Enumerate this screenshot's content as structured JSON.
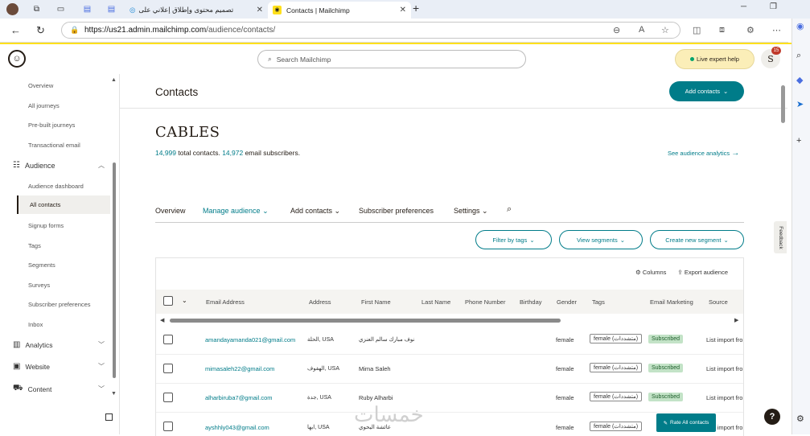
{
  "browser": {
    "tab1_title": "تصميم محتوى وإطلاق إعلاني على",
    "tab2_title": "Contacts | Mailchimp",
    "url_host": "https://us21.admin.mailchimp.com",
    "url_path": "/audience/contacts/"
  },
  "header": {
    "search_placeholder": "Search Mailchimp",
    "live_expert_label": "Live expert help",
    "avatar_letter": "S",
    "notification_count": "15"
  },
  "sidebar": {
    "items": [
      {
        "label": "Overview"
      },
      {
        "label": "All journeys"
      },
      {
        "label": "Pre-built journeys"
      },
      {
        "label": "Transactional email"
      }
    ],
    "audience_group": "Audience",
    "audience_items": [
      {
        "label": "Audience dashboard"
      },
      {
        "label": "All contacts"
      },
      {
        "label": "Signup forms"
      },
      {
        "label": "Tags"
      },
      {
        "label": "Segments"
      },
      {
        "label": "Surveys"
      },
      {
        "label": "Subscriber preferences"
      },
      {
        "label": "Inbox"
      }
    ],
    "groups": [
      {
        "label": "Analytics"
      },
      {
        "label": "Website"
      },
      {
        "label": "Content"
      }
    ]
  },
  "main": {
    "page_title": "Contacts",
    "add_contacts_btn": "Add contacts",
    "audience_name": "CABLES",
    "total_contacts": "14,999",
    "total_contacts_suffix": "total contacts.",
    "email_subscribers": "14,972",
    "email_subscribers_suffix": "email subscribers.",
    "see_analytics": "See audience analytics",
    "tabs": [
      {
        "label": "Overview"
      },
      {
        "label": "Manage audience"
      },
      {
        "label": "Add contacts"
      },
      {
        "label": "Subscriber preferences"
      },
      {
        "label": "Settings"
      }
    ],
    "filter_btns": [
      {
        "label": "Filter by tags"
      },
      {
        "label": "View segments"
      },
      {
        "label": "Create new segment"
      }
    ],
    "columns_btn": "Columns",
    "export_btn": "Export audience",
    "columns": [
      "Email Address",
      "Address",
      "First Name",
      "Last Name",
      "Phone Number",
      "Birthday",
      "Gender",
      "Tags",
      "Email Marketing",
      "Source"
    ],
    "rows": [
      {
        "email": "amandayamanda021@gmail.com",
        "address": "الحلة, USA",
        "first": "نوف مبارك سالم العنزي",
        "gender": "female",
        "tag": "female (متشددات)",
        "status": "Subscribed",
        "source": "List import fro"
      },
      {
        "email": "mimasaleh22@gmail.com",
        "address": "الهفوف, USA",
        "first": "Mima Saleh",
        "gender": "female",
        "tag": "female (متشددات)",
        "status": "Subscribed",
        "source": "List import fro"
      },
      {
        "email": "alharbiruba7@gmail.com",
        "address": "جدة, USA",
        "first": "Ruby Alharbi",
        "gender": "female",
        "tag": "female (متشددات)",
        "status": "Subscribed",
        "source": "List import fro"
      },
      {
        "email": "ayshhly043@gmail.com",
        "address": "ابها, USA",
        "first": "عائشة اليحوي",
        "gender": "female",
        "tag": "female (متشددات)",
        "status": "Subscribed",
        "source": "List import fro"
      }
    ],
    "rate_btn": "Rate All contacts",
    "feedback": "Feedback",
    "help": "?"
  },
  "watermark": "خمسات",
  "colors": {
    "accent": "#007c89",
    "brand_yellow": "#ffe01b",
    "subscribed_bg": "#c3e3c7"
  }
}
